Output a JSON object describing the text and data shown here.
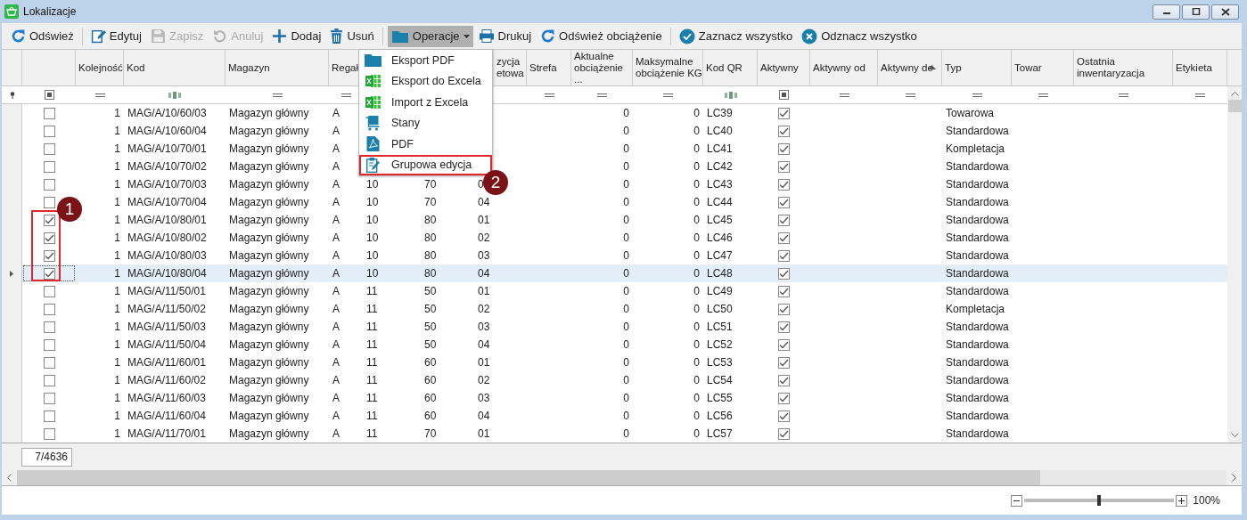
{
  "window": {
    "title": "Lokalizacje"
  },
  "toolbar": [
    {
      "kind": "button",
      "label": "Odśwież",
      "disabled": false
    },
    {
      "kind": "separator"
    },
    {
      "kind": "button",
      "label": "Edytuj",
      "disabled": false
    },
    {
      "kind": "button",
      "label": "Zapisz",
      "disabled": true
    },
    {
      "kind": "button",
      "label": "Anuluj",
      "disabled": true
    },
    {
      "kind": "button",
      "label": "Dodaj",
      "disabled": false
    },
    {
      "kind": "button",
      "label": "Usuń",
      "disabled": false
    },
    {
      "kind": "separator"
    },
    {
      "kind": "dropdown",
      "label": "Operacje",
      "disabled": false,
      "open": true
    },
    {
      "kind": "button",
      "label": "Drukuj",
      "disabled": false
    },
    {
      "kind": "button",
      "label": "Odśwież obciążenie",
      "disabled": false
    },
    {
      "kind": "separator"
    },
    {
      "kind": "button",
      "label": "Zaznacz wszystko",
      "disabled": false
    },
    {
      "kind": "button",
      "label": "Odznacz wszystko",
      "disabled": false
    }
  ],
  "menu": {
    "items": [
      {
        "label": "Eksport PDF",
        "marked": false
      },
      {
        "label": "Eksport do Excela",
        "marked": false
      },
      {
        "label": "Import z Excela",
        "marked": false
      },
      {
        "label": "Stany",
        "marked": false
      },
      {
        "label": "PDF",
        "marked": false
      },
      {
        "label": "Grupowa edycja",
        "marked": true
      }
    ]
  },
  "table": {
    "select_column": {
      "filter_partial": true
    },
    "columns": [
      {
        "kind": "text",
        "label": "Kolejność"
      },
      {
        "kind": "text",
        "label": "Kod"
      },
      {
        "kind": "text",
        "label": "Magazyn"
      },
      {
        "kind": "text",
        "label": "Regał"
      },
      {
        "kind": "covered"
      },
      {
        "kind": "covered"
      },
      {
        "kind": "text",
        "label": "zycja etowa"
      },
      {
        "kind": "text",
        "label": "Strefa"
      },
      {
        "kind": "text",
        "label": "Aktualne obciążenie ..."
      },
      {
        "kind": "text",
        "label": "Maksymalne obciążenie KG"
      },
      {
        "kind": "text",
        "label": "Kod QR"
      },
      {
        "kind": "text",
        "label": "Aktywny",
        "filter_partial": true
      },
      {
        "kind": "text",
        "label": "Aktywny od"
      },
      {
        "kind": "text",
        "label": "Aktywny do",
        "sorted_ascending": true
      },
      {
        "kind": "text",
        "label": "Typ"
      },
      {
        "kind": "text",
        "label": "Towar"
      },
      {
        "kind": "text",
        "label": "Ostatnia inwentaryzacja"
      },
      {
        "kind": "text",
        "label": "Etykieta"
      }
    ],
    "rows": [
      {
        "checked": false,
        "current": false,
        "cells": [
          "1",
          "MAG/A/10/60/03",
          "Magazyn główny",
          "A",
          null,
          null,
          null,
          null,
          "0",
          "0",
          "LC39",
          true,
          null,
          null,
          "Towarowa"
        ]
      },
      {
        "checked": false,
        "current": false,
        "cells": [
          "1",
          "MAG/A/10/60/04",
          "Magazyn główny",
          "A",
          null,
          null,
          null,
          null,
          "0",
          "0",
          "LC40",
          true,
          null,
          null,
          "Standardowa"
        ]
      },
      {
        "checked": false,
        "current": false,
        "cells": [
          "1",
          "MAG/A/10/70/01",
          "Magazyn główny",
          "A",
          null,
          null,
          null,
          null,
          "0",
          "0",
          "LC41",
          true,
          null,
          null,
          "Kompletacja"
        ]
      },
      {
        "checked": false,
        "current": false,
        "cells": [
          "1",
          "MAG/A/10/70/02",
          "Magazyn główny",
          "A",
          null,
          null,
          null,
          null,
          "0",
          "0",
          "LC42",
          true,
          null,
          null,
          "Standardowa"
        ]
      },
      {
        "checked": false,
        "current": false,
        "cells": [
          "1",
          "MAG/A/10/70/03",
          "Magazyn główny",
          "A",
          "10",
          "70",
          "0",
          null,
          "0",
          "0",
          "LC43",
          true,
          null,
          null,
          "Standardowa"
        ]
      },
      {
        "checked": false,
        "current": false,
        "cells": [
          "1",
          "MAG/A/10/70/04",
          "Magazyn główny",
          "A",
          "10",
          "70",
          "04",
          null,
          "0",
          "0",
          "LC44",
          true,
          null,
          null,
          "Standardowa"
        ]
      },
      {
        "checked": true,
        "current": false,
        "cells": [
          "1",
          "MAG/A/10/80/01",
          "Magazyn główny",
          "A",
          "10",
          "80",
          "01",
          null,
          "0",
          "0",
          "LC45",
          true,
          null,
          null,
          "Standardowa"
        ]
      },
      {
        "checked": true,
        "current": false,
        "cells": [
          "1",
          "MAG/A/10/80/02",
          "Magazyn główny",
          "A",
          "10",
          "80",
          "02",
          null,
          "0",
          "0",
          "LC46",
          true,
          null,
          null,
          "Standardowa"
        ]
      },
      {
        "checked": true,
        "current": false,
        "cells": [
          "1",
          "MAG/A/10/80/03",
          "Magazyn główny",
          "A",
          "10",
          "80",
          "03",
          null,
          "0",
          "0",
          "LC47",
          true,
          null,
          null,
          "Standardowa"
        ]
      },
      {
        "checked": true,
        "current": true,
        "cells": [
          "1",
          "MAG/A/10/80/04",
          "Magazyn główny",
          "A",
          "10",
          "80",
          "04",
          null,
          "0",
          "0",
          "LC48",
          true,
          null,
          null,
          "Standardowa"
        ]
      },
      {
        "checked": false,
        "current": false,
        "cells": [
          "1",
          "MAG/A/11/50/01",
          "Magazyn główny",
          "A",
          "11",
          "50",
          "01",
          null,
          "0",
          "0",
          "LC49",
          true,
          null,
          null,
          "Standardowa"
        ]
      },
      {
        "checked": false,
        "current": false,
        "cells": [
          "1",
          "MAG/A/11/50/02",
          "Magazyn główny",
          "A",
          "11",
          "50",
          "02",
          null,
          "0",
          "0",
          "LC50",
          true,
          null,
          null,
          "Kompletacja"
        ]
      },
      {
        "checked": false,
        "current": false,
        "cells": [
          "1",
          "MAG/A/11/50/03",
          "Magazyn główny",
          "A",
          "11",
          "50",
          "03",
          null,
          "0",
          "0",
          "LC51",
          true,
          null,
          null,
          "Standardowa"
        ]
      },
      {
        "checked": false,
        "current": false,
        "cells": [
          "1",
          "MAG/A/11/50/04",
          "Magazyn główny",
          "A",
          "11",
          "50",
          "04",
          null,
          "0",
          "0",
          "LC52",
          true,
          null,
          null,
          "Standardowa"
        ]
      },
      {
        "checked": false,
        "current": false,
        "cells": [
          "1",
          "MAG/A/11/60/01",
          "Magazyn główny",
          "A",
          "11",
          "60",
          "01",
          null,
          "0",
          "0",
          "LC53",
          true,
          null,
          null,
          "Standardowa"
        ]
      },
      {
        "checked": false,
        "current": false,
        "cells": [
          "1",
          "MAG/A/11/60/02",
          "Magazyn główny",
          "A",
          "11",
          "60",
          "02",
          null,
          "0",
          "0",
          "LC54",
          true,
          null,
          null,
          "Standardowa"
        ]
      },
      {
        "checked": false,
        "current": false,
        "cells": [
          "1",
          "MAG/A/11/60/03",
          "Magazyn główny",
          "A",
          "11",
          "60",
          "03",
          null,
          "0",
          "0",
          "LC55",
          true,
          null,
          null,
          "Standardowa"
        ]
      },
      {
        "checked": false,
        "current": false,
        "cells": [
          "1",
          "MAG/A/11/60/04",
          "Magazyn główny",
          "A",
          "11",
          "60",
          "04",
          null,
          "0",
          "0",
          "LC56",
          true,
          null,
          null,
          "Standardowa"
        ]
      },
      {
        "checked": false,
        "current": false,
        "cells": [
          "1",
          "MAG/A/11/70/01",
          "Magazyn główny",
          "A",
          "11",
          "70",
          "01",
          null,
          "0",
          "0",
          "LC57",
          true,
          null,
          null,
          "Standardowa"
        ]
      }
    ]
  },
  "record_counter": "7/4636",
  "zoom": {
    "level": 0.5,
    "reading": "100%"
  },
  "annotations": [
    {
      "label": "1"
    },
    {
      "label": "2"
    }
  ]
}
